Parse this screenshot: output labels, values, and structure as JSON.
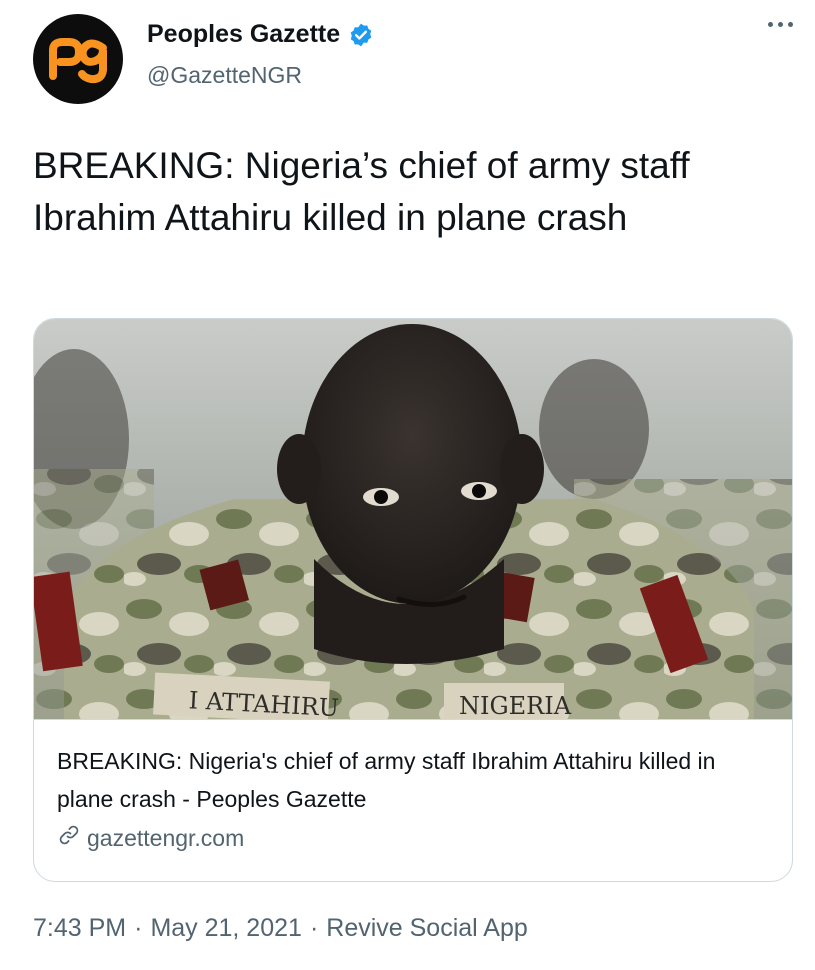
{
  "author": {
    "display_name": "Peoples Gazette",
    "handle": "@GazetteNGR",
    "avatar_text": "pg",
    "verified": true
  },
  "tweet": {
    "text": "BREAKING: Nigeria’s chief of army staff Ibrahim Attahiru killed in plane crash"
  },
  "card": {
    "image_texts": [
      "I ATTAHIRU",
      "NIGERIA"
    ],
    "title": "BREAKING: Nigeria's chief of army staff Ibrahim Attahiru killed in plane crash - Peoples Gazette",
    "domain": "gazettengr.com"
  },
  "meta": {
    "time": "7:43 PM",
    "separator": "·",
    "date": "May 21, 2021",
    "source": "Revive Social App"
  },
  "colors": {
    "brand_orange": "#f7931e",
    "verified_blue": "#1d9bf0",
    "secondary_text": "#536471",
    "border": "#cfd9de"
  },
  "icons": [
    "more-icon",
    "verified-badge-icon",
    "link-icon"
  ]
}
